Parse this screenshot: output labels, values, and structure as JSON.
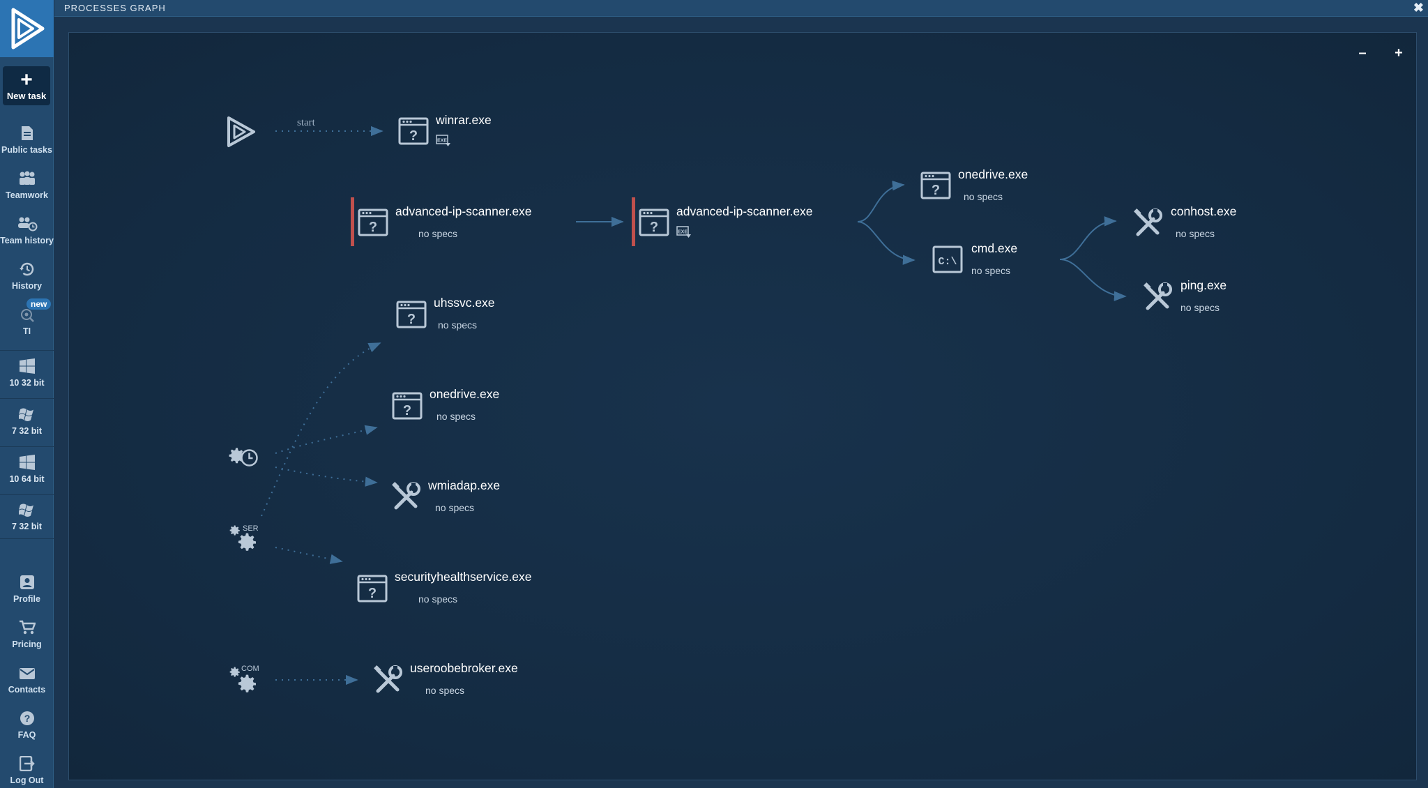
{
  "window": {
    "title": "PROCESSES GRAPH",
    "close_glyph": "✖"
  },
  "sidebar": {
    "new_task": {
      "icon": "plus-icon",
      "label": "New task"
    },
    "items": [
      {
        "icon": "document-icon",
        "label": "Public tasks"
      },
      {
        "icon": "team-icon",
        "label": "Teamwork"
      },
      {
        "icon": "team-history-icon",
        "label": "Team history"
      },
      {
        "icon": "history-icon",
        "label": "History"
      },
      {
        "icon": "ti-icon",
        "label": "TI",
        "badge": "new"
      }
    ],
    "os": [
      {
        "icon": "windows10-icon",
        "label": "10 32 bit"
      },
      {
        "icon": "windows7-icon",
        "label": "7 32 bit"
      },
      {
        "icon": "windows10-icon",
        "label": "10 64 bit"
      },
      {
        "icon": "windows7-icon",
        "label": "7 32 bit"
      }
    ],
    "bottom": [
      {
        "icon": "profile-icon",
        "label": "Profile"
      },
      {
        "icon": "cart-icon",
        "label": "Pricing"
      },
      {
        "icon": "mail-icon",
        "label": "Contacts"
      },
      {
        "icon": "question-icon",
        "label": "FAQ"
      },
      {
        "icon": "logout-icon",
        "label": "Log Out"
      }
    ]
  },
  "graph": {
    "zoom_out": "–",
    "zoom_in": "+",
    "start_label": "start",
    "nodes": {
      "winrar": {
        "name": "winrar.exe",
        "icon": "unknown-window-icon",
        "exe_badge": "exe-icon"
      },
      "ipscan1": {
        "name": "advanced-ip-scanner.exe",
        "spec": "no specs",
        "icon": "unknown-window-icon"
      },
      "ipscan2": {
        "name": "advanced-ip-scanner.exe",
        "icon": "unknown-window-icon",
        "exe_badge": "exe-icon"
      },
      "onedrive1": {
        "name": "onedrive.exe",
        "spec": "no specs",
        "icon": "unknown-window-icon"
      },
      "cmd": {
        "name": "cmd.exe",
        "spec": "no specs",
        "icon": "cmd-icon",
        "icon_text": "C:\\"
      },
      "conhost": {
        "name": "conhost.exe",
        "spec": "no specs",
        "icon": "tools-icon"
      },
      "ping": {
        "name": "ping.exe",
        "spec": "no specs",
        "icon": "tools-icon"
      },
      "uhssvc": {
        "name": "uhssvc.exe",
        "spec": "no specs",
        "icon": "unknown-window-icon"
      },
      "onedrive2": {
        "name": "onedrive.exe",
        "spec": "no specs",
        "icon": "unknown-window-icon"
      },
      "wmiadap": {
        "name": "wmiadap.exe",
        "spec": "no specs",
        "icon": "tools-icon"
      },
      "securityhealth": {
        "name": "securityhealthservice.exe",
        "spec": "no specs",
        "icon": "unknown-window-icon"
      },
      "useroobe": {
        "name": "useroobebroker.exe",
        "spec": "no specs",
        "icon": "tools-icon"
      }
    },
    "sources": [
      {
        "icon": "scheduler-gear-icon"
      },
      {
        "icon": "services-gear-icon",
        "tag": "SER"
      },
      {
        "icon": "com-gear-icon",
        "tag": "COM"
      }
    ]
  },
  "colors": {
    "accent": "#2c74b3",
    "edge": "#3f6f98",
    "suspicious": "#c0504d"
  }
}
